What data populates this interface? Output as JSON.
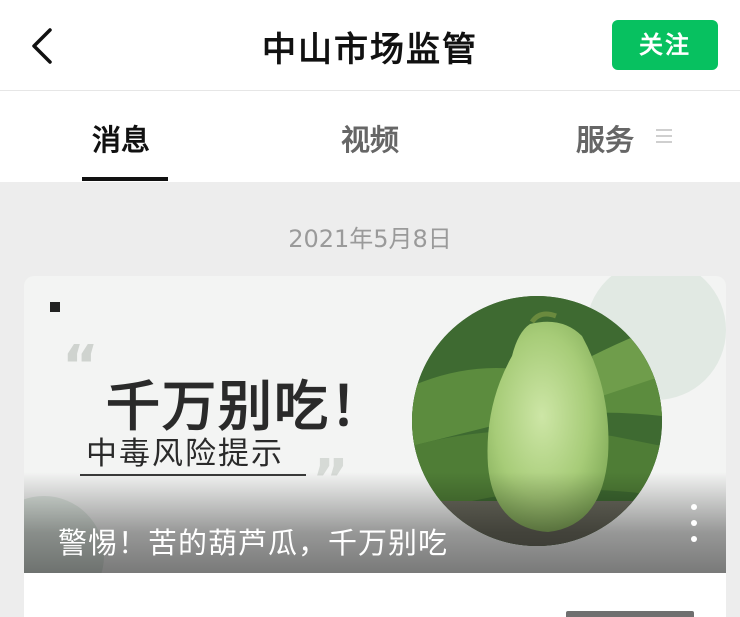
{
  "header": {
    "back_icon": "chevron-left-icon",
    "title": "中山市场监管",
    "follow_label": "关注",
    "follow_color": "#07c160"
  },
  "tabs": [
    {
      "label": "消息",
      "active": true
    },
    {
      "label": "视频",
      "active": false
    },
    {
      "label": "服务",
      "active": false,
      "icon": "menu-lines-icon"
    }
  ],
  "feed": {
    "date": "2021年5月8日",
    "article": {
      "cover_headline": "千万别吃！",
      "cover_subline": "中毒风险提示",
      "title": "警惕！苦的葫芦瓜，千万别吃",
      "more_icon": "more-vertical-icon"
    }
  }
}
